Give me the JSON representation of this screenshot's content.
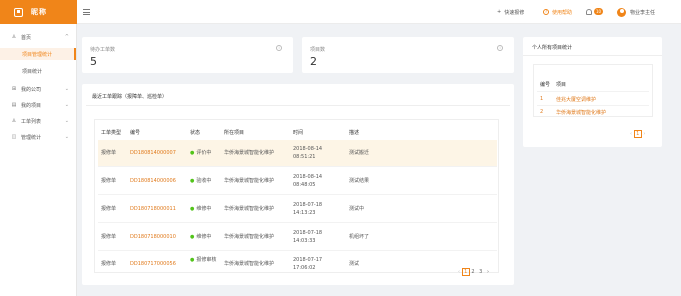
{
  "brand": {
    "name": "昵称"
  },
  "sidebar": {
    "items": [
      {
        "label": "首页",
        "icon": "user-icon",
        "glyph": "♙",
        "chevron": "^"
      },
      {
        "label": "项目管理统计",
        "active": true
      },
      {
        "label": "项目统计"
      },
      {
        "label": "我的公司",
        "icon": "grid-icon",
        "glyph": "⊞",
        "chevron": "⌄"
      },
      {
        "label": "我的项目",
        "icon": "doc-icon",
        "glyph": "▤",
        "chevron": "⌄"
      },
      {
        "label": "工单列表",
        "icon": "person-icon",
        "glyph": "♙",
        "chevron": "⌄"
      },
      {
        "label": "管理统计",
        "icon": "chart-icon",
        "glyph": "◫",
        "chevron": "⌄"
      }
    ]
  },
  "header": {
    "quick_report": "快速报修",
    "quick_report_glyph": "+",
    "help": "使用帮助",
    "help_glyph": "?",
    "notifications_badge": "10",
    "user_name": "物业李主任"
  },
  "stats": {
    "pending_orders": {
      "label": "待办工单数",
      "value": "5"
    },
    "project_count": {
      "label": "项目数",
      "value": "2"
    },
    "info_glyph": "i"
  },
  "recent": {
    "title": "最近工单跟踪（报障单、巡检单）",
    "columns": [
      "工单类型",
      "编号",
      "状态",
      "所在项目",
      "时间",
      "描述"
    ],
    "rows": [
      {
        "type": "报修单",
        "number": "DD180814000007",
        "status": "评价中",
        "project": "华侨海景城智能化维护",
        "time": "2018-08-14 08:51:21",
        "desc": "测试搬迁",
        "highlight": true
      },
      {
        "type": "报修单",
        "number": "DD180814000006",
        "status": "验收中",
        "project": "华侨海景城智能化维护",
        "time": "2018-08-14 08:48:05",
        "desc": "测试结果"
      },
      {
        "type": "报修单",
        "number": "DD180718000011",
        "status": "维修中",
        "project": "华侨海景城智能化维护",
        "time": "2018-07-18 14:13:23",
        "desc": "测试中"
      },
      {
        "type": "报修单",
        "number": "DD180718000010",
        "status": "维修中",
        "project": "华侨海景城智能化维护",
        "time": "2018-07-18 14:03:33",
        "desc": "机组坏了"
      },
      {
        "type": "报修单",
        "number": "DD180717000056",
        "status": "报修审核",
        "project": "华侨海景城智能化维护",
        "time": "2018-07-17 17:06:02",
        "desc": "测试"
      }
    ],
    "pager": {
      "prev": "‹",
      "pages": [
        "1",
        "2",
        "3"
      ],
      "current": "1",
      "next": "›"
    }
  },
  "my_projects": {
    "title": "个人所有项目统计",
    "columns": [
      "编号",
      "项目"
    ],
    "rows": [
      {
        "id": "1",
        "name": "佳兆大厦空调维护"
      },
      {
        "id": "2",
        "name": "华侨海景城智能化维护"
      }
    ],
    "pager": {
      "prev": "‹",
      "current": "1",
      "next": "›"
    }
  },
  "colors": {
    "accent": "#f08519",
    "link": "#e07a1c",
    "status_dot": "#52c41a",
    "highlight_row": "#fdf5e6"
  }
}
